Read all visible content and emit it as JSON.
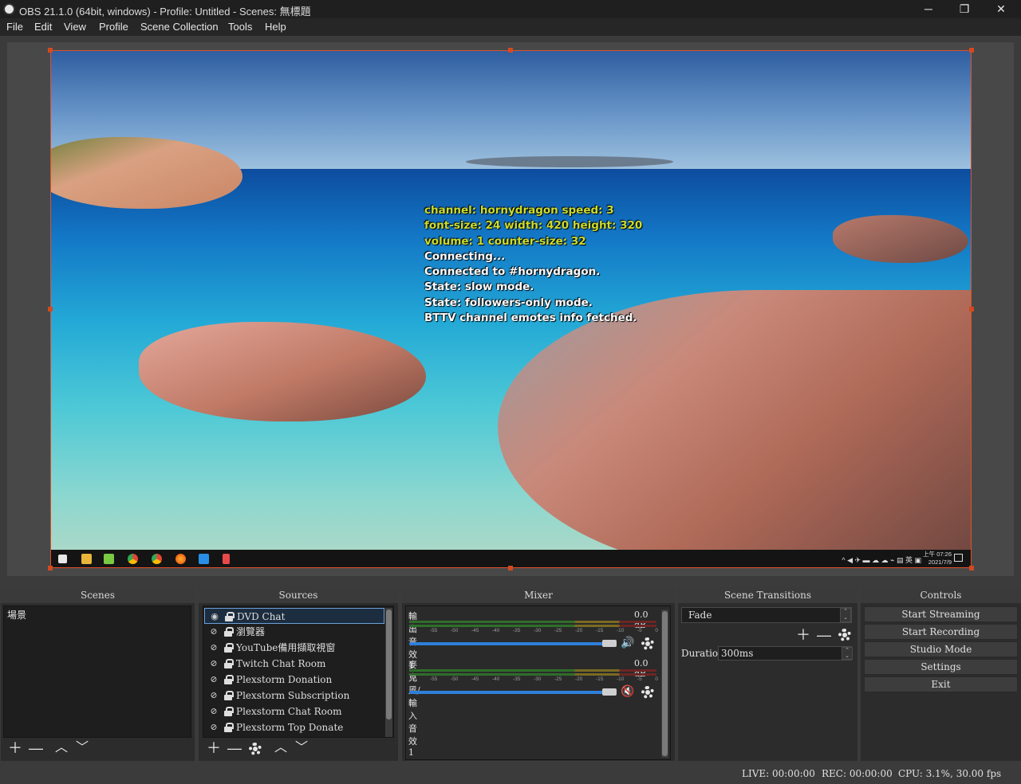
{
  "window": {
    "title": "OBS 21.1.0 (64bit, windows) - Profile: Untitled - Scenes: 無標題",
    "minimize": "─",
    "maximize": "❐",
    "close": "✕"
  },
  "menu": [
    "File",
    "Edit",
    "View",
    "Profile",
    "Scene Collection",
    "Tools",
    "Help"
  ],
  "preview": {
    "overlay_lines": [
      {
        "text": "channel: hornydragon speed: 3",
        "color": "#cddc2a"
      },
      {
        "text": "font-size: 24 width: 420 height: 320",
        "color": "#cddc2a"
      },
      {
        "text": "volume: 1 counter-size: 32",
        "color": "#cddc2a"
      },
      {
        "text": "Connecting...",
        "color": "#ffffff"
      },
      {
        "text": "Connected to #hornydragon.",
        "color": "#ffffff"
      },
      {
        "text": "State: slow mode.",
        "color": "#ffffff"
      },
      {
        "text": "State: followers-only mode.",
        "color": "#ffffff"
      },
      {
        "text": "BTTV channel emotes info fetched.",
        "color": "#ffffff"
      }
    ],
    "clock_time": "上午 07:26",
    "clock_date": "2021/7/9",
    "tray_lang": "英"
  },
  "panels": {
    "scenes": {
      "title": "Scenes",
      "items": [
        "場景"
      ]
    },
    "sources": {
      "title": "Sources",
      "items": [
        {
          "name": "DVD Chat",
          "visible": true,
          "selected": true
        },
        {
          "name": "瀏覽器",
          "visible": false,
          "selected": false
        },
        {
          "name": "YouTube備用擷取視窗",
          "visible": false,
          "selected": false
        },
        {
          "name": "Twitch Chat Room",
          "visible": false,
          "selected": false
        },
        {
          "name": "Plexstorm Donation",
          "visible": false,
          "selected": false
        },
        {
          "name": "Plexstorm Subscription",
          "visible": false,
          "selected": false
        },
        {
          "name": "Plexstorm Chat Room",
          "visible": false,
          "selected": false
        },
        {
          "name": "Plexstorm Top Donate",
          "visible": false,
          "selected": false
        }
      ]
    },
    "mixer": {
      "title": "Mixer",
      "tracks": [
        {
          "name": "輸出音效 1",
          "db": "0.0 dB",
          "muted": false,
          "volume_pct": 100
        },
        {
          "name": "麥克風/輸入音效 1",
          "db": "0.0 dB",
          "muted": true,
          "volume_pct": 100
        }
      ],
      "ticks": [
        "-60",
        "-55",
        "-50",
        "-45",
        "-40",
        "-35",
        "-30",
        "-25",
        "-20",
        "-15",
        "-10",
        "-5",
        "0"
      ]
    },
    "transitions": {
      "title": "Scene Transitions",
      "selected": "Fade",
      "duration_label": "Duration",
      "duration_value": "300ms"
    },
    "controls": {
      "title": "Controls",
      "buttons": [
        "Start Streaming",
        "Start Recording",
        "Studio Mode",
        "Settings",
        "Exit"
      ]
    }
  },
  "status": {
    "live": "LIVE: 00:00:00",
    "rec": "REC: 00:00:00",
    "cpu": "CPU: 3.1%, 30.00 fps"
  },
  "colors": {
    "accent": "#2e7fd9",
    "selection_border": "#d24a1e",
    "mute_red": "#e04040"
  }
}
